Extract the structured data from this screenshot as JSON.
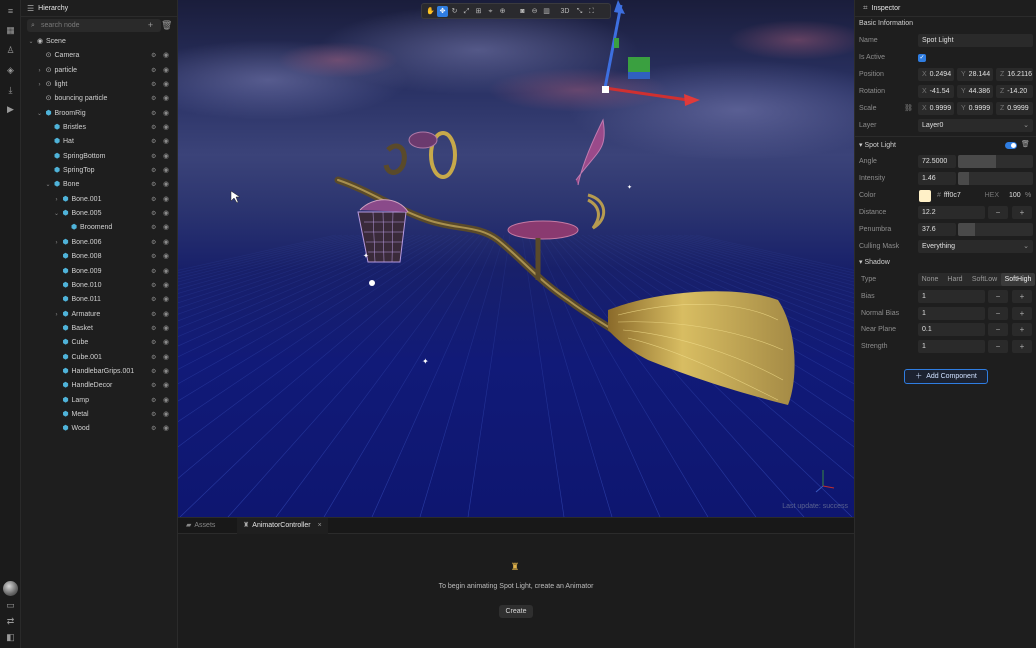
{
  "hierarchy": {
    "tab_label": "Hierarchy",
    "search_placeholder": "search node",
    "nodes": [
      {
        "label": "Scene",
        "depth": 0,
        "arrow": "expanded",
        "icon": "scene"
      },
      {
        "label": "Camera",
        "depth": 1,
        "arrow": "none",
        "icon": "node"
      },
      {
        "label": "particle",
        "depth": 1,
        "arrow": "collapsed",
        "icon": "node"
      },
      {
        "label": "light",
        "depth": 1,
        "arrow": "collapsed",
        "icon": "node"
      },
      {
        "label": "bouncing particle",
        "depth": 1,
        "arrow": "none",
        "icon": "node"
      },
      {
        "label": "BroomRig",
        "depth": 1,
        "arrow": "expanded",
        "icon": "cube"
      },
      {
        "label": "Bristles",
        "depth": 2,
        "arrow": "none",
        "icon": "cube"
      },
      {
        "label": "Hat",
        "depth": 2,
        "arrow": "none",
        "icon": "cube"
      },
      {
        "label": "SpringBottom",
        "depth": 2,
        "arrow": "none",
        "icon": "cube"
      },
      {
        "label": "SpringTop",
        "depth": 2,
        "arrow": "none",
        "icon": "cube"
      },
      {
        "label": "Bone",
        "depth": 2,
        "arrow": "expanded",
        "icon": "cube"
      },
      {
        "label": "Bone.001",
        "depth": 3,
        "arrow": "collapsed",
        "icon": "cube"
      },
      {
        "label": "Bone.005",
        "depth": 3,
        "arrow": "expanded",
        "icon": "cube"
      },
      {
        "label": "Broomend",
        "depth": 4,
        "arrow": "none",
        "icon": "cube"
      },
      {
        "label": "Bone.006",
        "depth": 3,
        "arrow": "collapsed",
        "icon": "cube"
      },
      {
        "label": "Bone.008",
        "depth": 3,
        "arrow": "none",
        "icon": "cube"
      },
      {
        "label": "Bone.009",
        "depth": 3,
        "arrow": "none",
        "icon": "cube"
      },
      {
        "label": "Bone.010",
        "depth": 3,
        "arrow": "none",
        "icon": "cube"
      },
      {
        "label": "Bone.011",
        "depth": 3,
        "arrow": "none",
        "icon": "cube"
      },
      {
        "label": "Armature",
        "depth": 3,
        "arrow": "collapsed",
        "icon": "cube"
      },
      {
        "label": "Basket",
        "depth": 3,
        "arrow": "none",
        "icon": "cube"
      },
      {
        "label": "Cube",
        "depth": 3,
        "arrow": "none",
        "icon": "cube"
      },
      {
        "label": "Cube.001",
        "depth": 3,
        "arrow": "none",
        "icon": "cube"
      },
      {
        "label": "HandlebarGrips.001",
        "depth": 3,
        "arrow": "none",
        "icon": "cube"
      },
      {
        "label": "HandleDecor",
        "depth": 3,
        "arrow": "none",
        "icon": "cube"
      },
      {
        "label": "Lamp",
        "depth": 3,
        "arrow": "none",
        "icon": "cube"
      },
      {
        "label": "Metal",
        "depth": 3,
        "arrow": "none",
        "icon": "cube"
      },
      {
        "label": "Wood",
        "depth": 3,
        "arrow": "none",
        "icon": "cube"
      }
    ]
  },
  "viewport": {
    "toolbar_3d_label": "3D",
    "status_text": "Last update: success"
  },
  "bottom": {
    "tabs": [
      "Assets",
      "AnimatorController"
    ],
    "active_tab": "AnimatorController",
    "message": "To begin animating Spot Light, create an Animator",
    "create_label": "Create"
  },
  "inspector": {
    "tab_label": "Inspector",
    "basic_info_title": "Basic Information",
    "name_label": "Name",
    "name_value": "Spot Light",
    "active_label": "Is Active",
    "position_label": "Position",
    "position": {
      "x": "0.2494",
      "y": "28.144",
      "z": "16.2116"
    },
    "rotation_label": "Rotation",
    "rotation": {
      "x": "-41.54",
      "y": "44.386",
      "z": "-14.20"
    },
    "scale_label": "Scale",
    "scale": {
      "x": "0.9999",
      "y": "0.9999",
      "z": "0.9999"
    },
    "layer_label": "Layer",
    "layer_value": "Layer0",
    "spot_title": "Spot Light",
    "angle_label": "Angle",
    "angle_value": "72.5000",
    "angle_fill": 0.5,
    "intensity_label": "Intensity",
    "intensity_value": "1.46",
    "intensity_fill": 0.15,
    "color_label": "Color",
    "color_hex": "fff0c7",
    "color_hex_label": "HEX",
    "color_alpha": "100",
    "color_alpha_unit": "%",
    "distance_label": "Distance",
    "distance_value": "12.2",
    "penumbra_label": "Penumbra",
    "penumbra_value": "37.6",
    "penumbra_fill": 0.22,
    "culling_label": "Culling Mask",
    "culling_value": "Everything",
    "shadow_title": "Shadow",
    "type_label": "Type",
    "type_options": [
      "None",
      "Hard",
      "SoftLow",
      "SoftHigh"
    ],
    "type_selected": "SoftHigh",
    "bias_label": "Bias",
    "bias_value": "1",
    "normal_bias_label": "Normal Bias",
    "normal_bias_value": "1",
    "near_plane_label": "Near Plane",
    "near_plane_value": "0.1",
    "strength_label": "Strength",
    "strength_value": "1",
    "add_component_label": "Add Component"
  },
  "colors": {
    "accent": "#2f7de1",
    "node_icon": "#4fb3d9",
    "light_color": "#fff0c7"
  }
}
